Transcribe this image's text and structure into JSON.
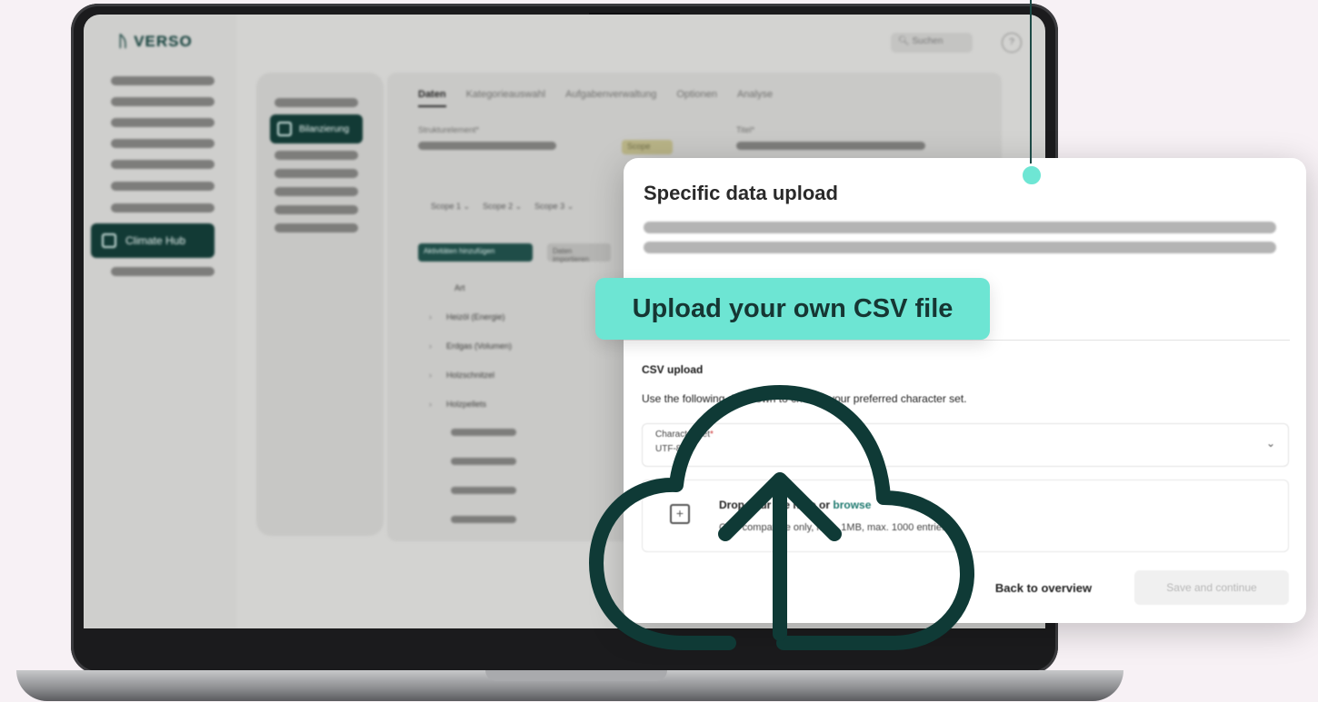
{
  "app": {
    "logo": "VERSO",
    "search_placeholder": "Suchen",
    "help_label": "?",
    "sidebar_active_item": "Climate Hub",
    "subnav_active_item": "Bilanzierung",
    "tabs": [
      {
        "label": "Daten",
        "active": true
      },
      {
        "label": "Kategorieauswahl",
        "active": false
      },
      {
        "label": "Aufgabenverwaltung",
        "active": false
      },
      {
        "label": "Optionen",
        "active": false
      },
      {
        "label": "Analyse",
        "active": false
      }
    ],
    "field_structure_label": "Strukturelement*",
    "field_title_label": "Titel*",
    "scope_badge": "Scope",
    "scopes": [
      "Scope 1",
      "Scope 2",
      "Scope 3"
    ],
    "primary_button": "Aktivitäten hinzufügen",
    "secondary_button": "Daten importieren",
    "tree_header": "Art",
    "tree_rows": [
      "Heizöl (Energie)",
      "Erdgas (Volumen)",
      "Holzschnitzel",
      "Holzpellets"
    ]
  },
  "dialog": {
    "title": "Specific data upload",
    "csv_section_title": "CSV upload",
    "csv_description": "Use the following dropdown to choose your preferred character set.",
    "charset_label": "Character set",
    "charset_value": "UTF-8",
    "drop_text": "Drop your file here or",
    "drop_link": "browse",
    "drop_hint": "CSV compatible only, max. 1MB, max. 1000 entries",
    "back_button": "Back to overview",
    "save_button": "Save and continue"
  },
  "callout": {
    "label": "Upload your own CSV file",
    "icon": "cloud-upload-icon"
  },
  "colors": {
    "accent": "#6de5d3",
    "dark_green": "#123a35",
    "background": "#f7f1f5"
  }
}
